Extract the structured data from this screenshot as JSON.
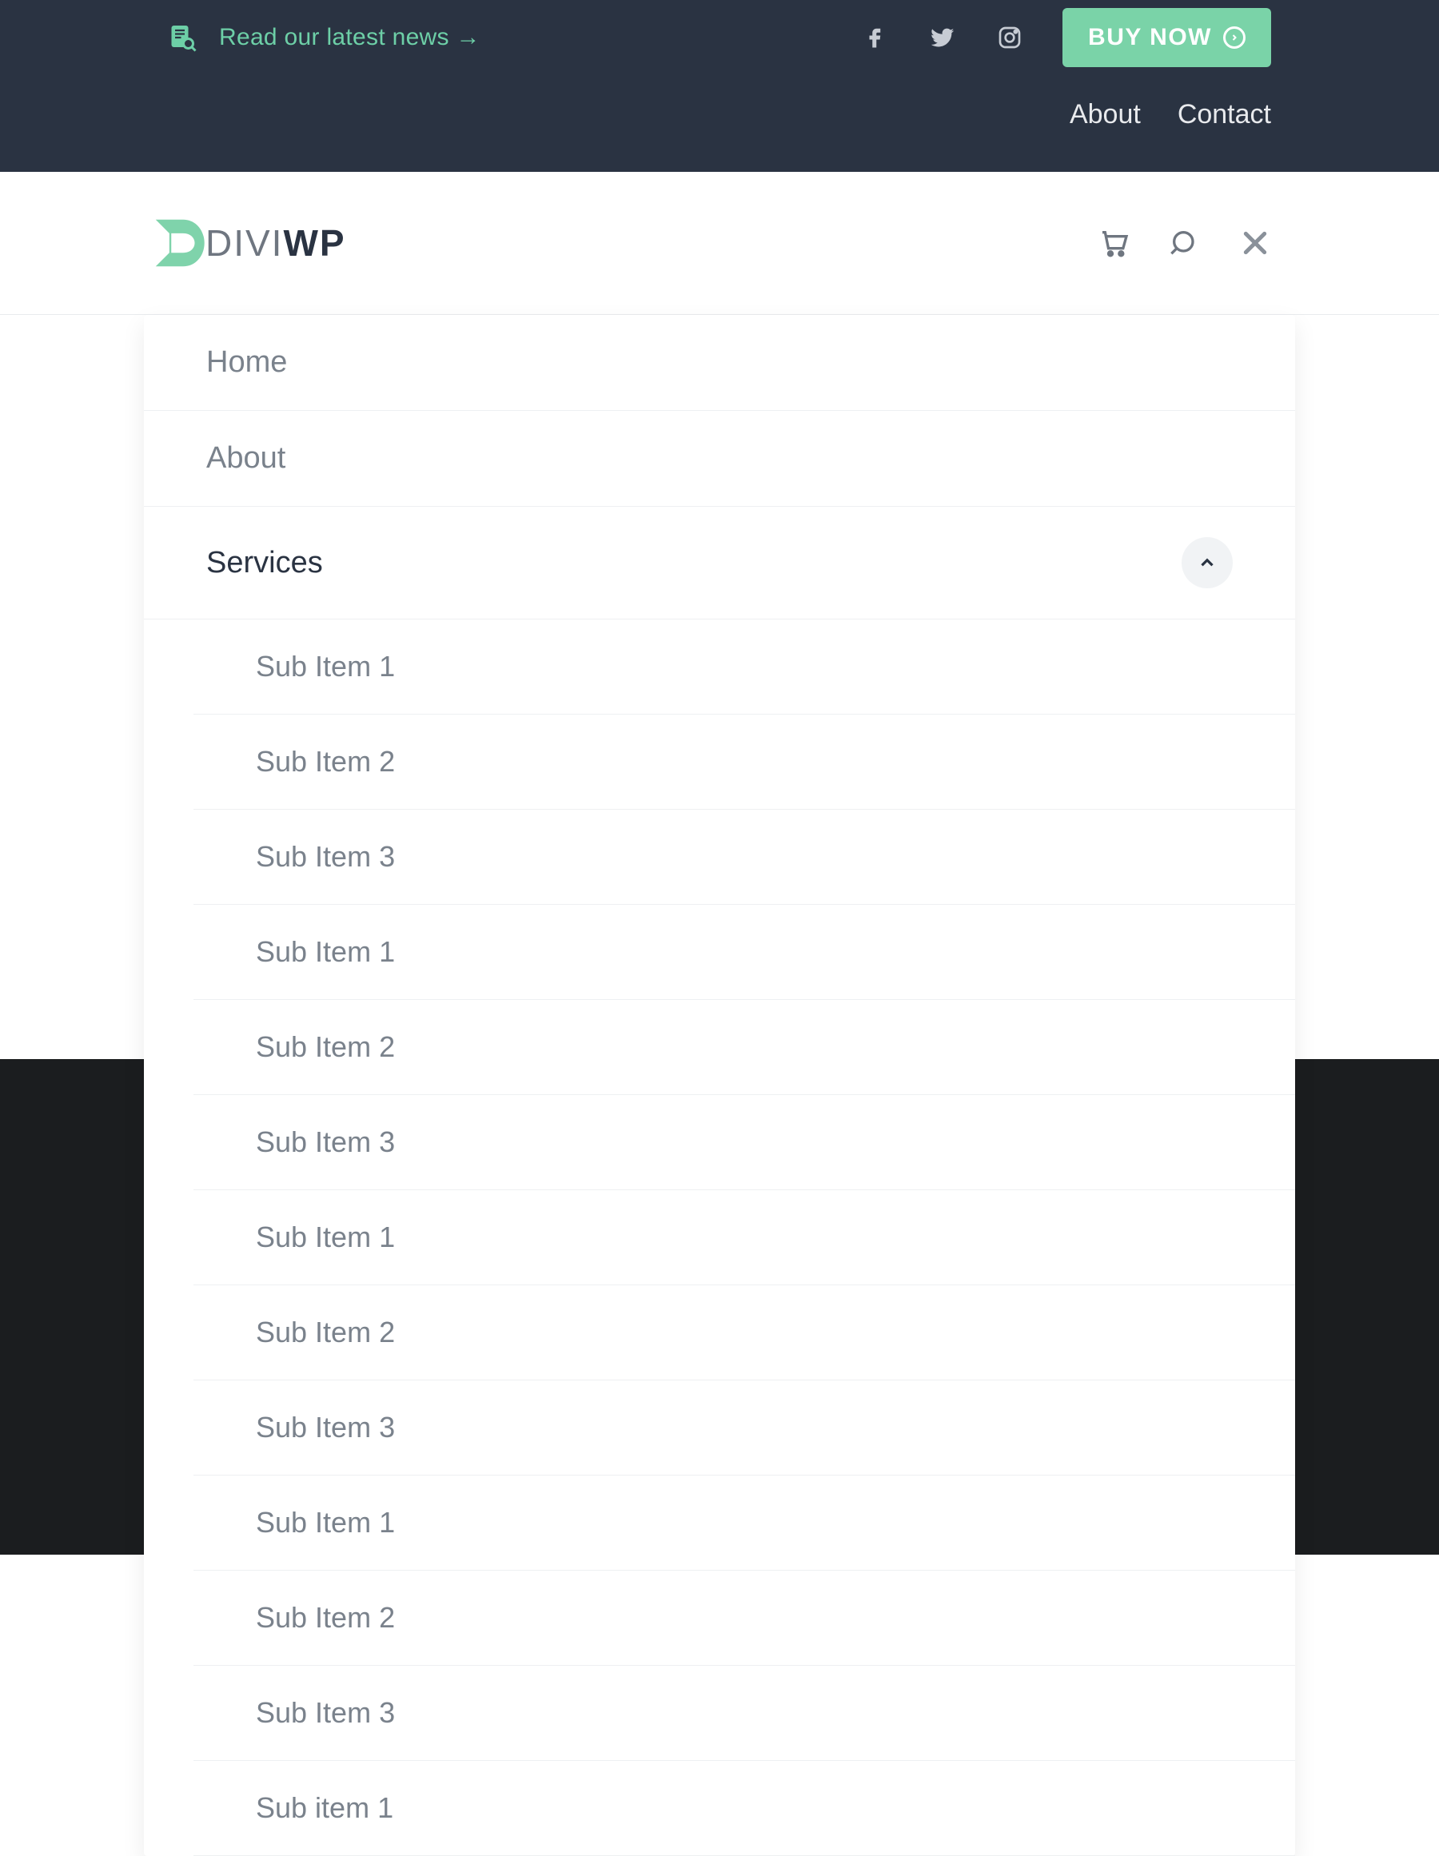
{
  "topbar": {
    "news_link": "Read our latest news →",
    "buy_label": "BUY NOW",
    "nav": {
      "about": "About",
      "contact": "Contact"
    }
  },
  "logo": {
    "part1": "DIVI",
    "part2": "WP"
  },
  "menu": {
    "items": [
      {
        "label": "Home"
      },
      {
        "label": "About"
      },
      {
        "label": "Services",
        "active": true
      }
    ],
    "sub": [
      "Sub Item 1",
      "Sub Item 2",
      "Sub Item 3",
      "Sub Item 1",
      "Sub Item 2",
      "Sub Item 3",
      "Sub Item 1",
      "Sub Item 2",
      "Sub Item 3",
      "Sub Item 1",
      "Sub Item 2",
      "Sub Item 3",
      "Sub item 1"
    ]
  }
}
